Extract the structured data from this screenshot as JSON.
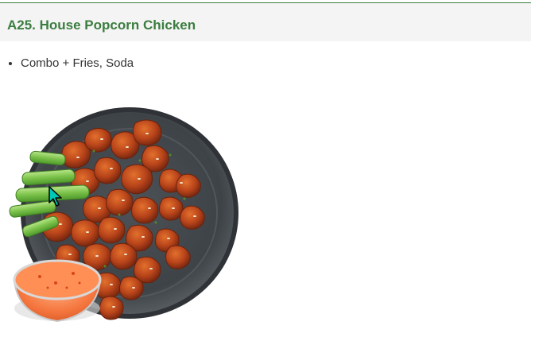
{
  "header": {
    "title": "A25. House Popcorn Chicken"
  },
  "options": [
    "Combo + Fries, Soda"
  ],
  "image": {
    "subject": "popcorn-chicken-plate-image"
  },
  "colors": {
    "accent": "#3b7d3f",
    "title_bar_bg": "#f4f4f4",
    "text": "#333333",
    "cursor": "#00c8b4"
  }
}
